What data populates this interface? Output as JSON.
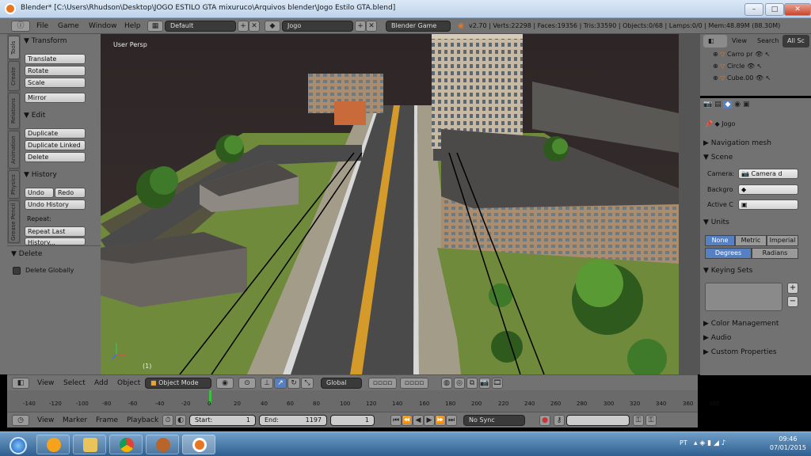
{
  "window": {
    "title": "Blender* [C:\\Users\\Rhudson\\Desktop\\JOGO ESTILO GTA mixuruco\\Arquivos blender\\Jogo Estilo GTA.blend]",
    "minimize": "–",
    "maximize": "□",
    "close": "✕"
  },
  "info_header": {
    "menu": [
      "File",
      "Game",
      "Window",
      "Help"
    ],
    "layout": "Default",
    "scene": "Jogo",
    "engine": "Blender Game",
    "stats": "v2.70 | Verts:22298 | Faces:19356 | Tris:33590 | Objects:0/68 | Lamps:0/0 | Mem:48.89M (88.30M)"
  },
  "tool_tabs": [
    "Tools",
    "Create",
    "Relations",
    "Animation",
    "Physics",
    "Grease Pencil"
  ],
  "tool_shelf": {
    "transform": {
      "title": "Transform",
      "buttons": [
        "Translate",
        "Rotate",
        "Scale",
        "Mirror"
      ]
    },
    "edit": {
      "title": "Edit",
      "buttons": [
        "Duplicate",
        "Duplicate Linked",
        "Delete"
      ]
    },
    "history": {
      "title": "History",
      "undo": "Undo",
      "redo": "Redo",
      "undo_history": "Undo History",
      "repeat_label": "Repeat:",
      "repeat_last": "Repeat Last",
      "history": "History..."
    },
    "operator": {
      "title": "Delete",
      "delete_globally": "Delete Globally"
    }
  },
  "viewport": {
    "label": "User Persp",
    "frame_number": "(1)"
  },
  "outliner": {
    "view": "View",
    "search": "Search",
    "all_scenes": "All Sc",
    "items": [
      "Carro pr",
      "Circle",
      "Cube.00"
    ]
  },
  "properties": {
    "scene_name": "Jogo",
    "navigation_mesh": "Navigation mesh",
    "scene": "Scene",
    "camera_label": "Camera:",
    "camera_value": "Camera d",
    "background_label": "Backgro",
    "active_clip_label": "Active C",
    "units": "Units",
    "unit_systems": [
      "None",
      "Metric",
      "Imperial"
    ],
    "rotation_units": [
      "Degrees",
      "Radians"
    ],
    "keying_sets": "Keying Sets",
    "color_management": "Color Management",
    "audio": "Audio",
    "custom_properties": "Custom Properties"
  },
  "view3d_header": {
    "menu": [
      "View",
      "Select",
      "Add",
      "Object"
    ],
    "mode": "Object Mode",
    "orientation": "Global"
  },
  "timeline": {
    "ticks": [
      "-140",
      "-120",
      "-100",
      "-80",
      "-60",
      "-40",
      "-20",
      "0",
      "20",
      "40",
      "60",
      "80",
      "100",
      "120",
      "140",
      "160",
      "180",
      "200",
      "220",
      "240",
      "260",
      "280",
      "300",
      "320",
      "340",
      "360",
      "380"
    ],
    "current_frame": 1,
    "menu": [
      "View",
      "Marker",
      "Frame",
      "Playback"
    ],
    "start_label": "Start:",
    "start_value": "1",
    "end_label": "End:",
    "end_value": "1197",
    "frame_value": "1",
    "sync": "No Sync"
  },
  "taskbar": {
    "apps": [
      "start-button",
      "media-player",
      "file-explorer",
      "chrome",
      "games",
      "blender"
    ],
    "time": "09:46",
    "date": "07/01/2015",
    "tray_hint": "PT"
  }
}
